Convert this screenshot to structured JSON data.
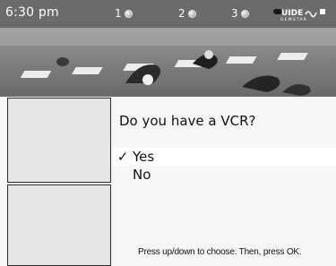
{
  "status_bar": {
    "time": "6:30 pm",
    "cameras": [
      {
        "label": "1"
      },
      {
        "label": "2"
      },
      {
        "label": "3"
      }
    ],
    "logo_text": "GUIDE+ GEMSTAR"
  },
  "dialog": {
    "question": "Do you have a VCR?",
    "options": [
      {
        "label": "Yes",
        "selected": true,
        "mark": "✓"
      },
      {
        "label": "No",
        "selected": false,
        "mark": ""
      }
    ],
    "hint": "Press up/down to choose. Then, press OK."
  },
  "colors": {
    "top_bar": "#6b6b6b",
    "panel": "#f6f6f6",
    "selected_row": "#ffffff"
  }
}
